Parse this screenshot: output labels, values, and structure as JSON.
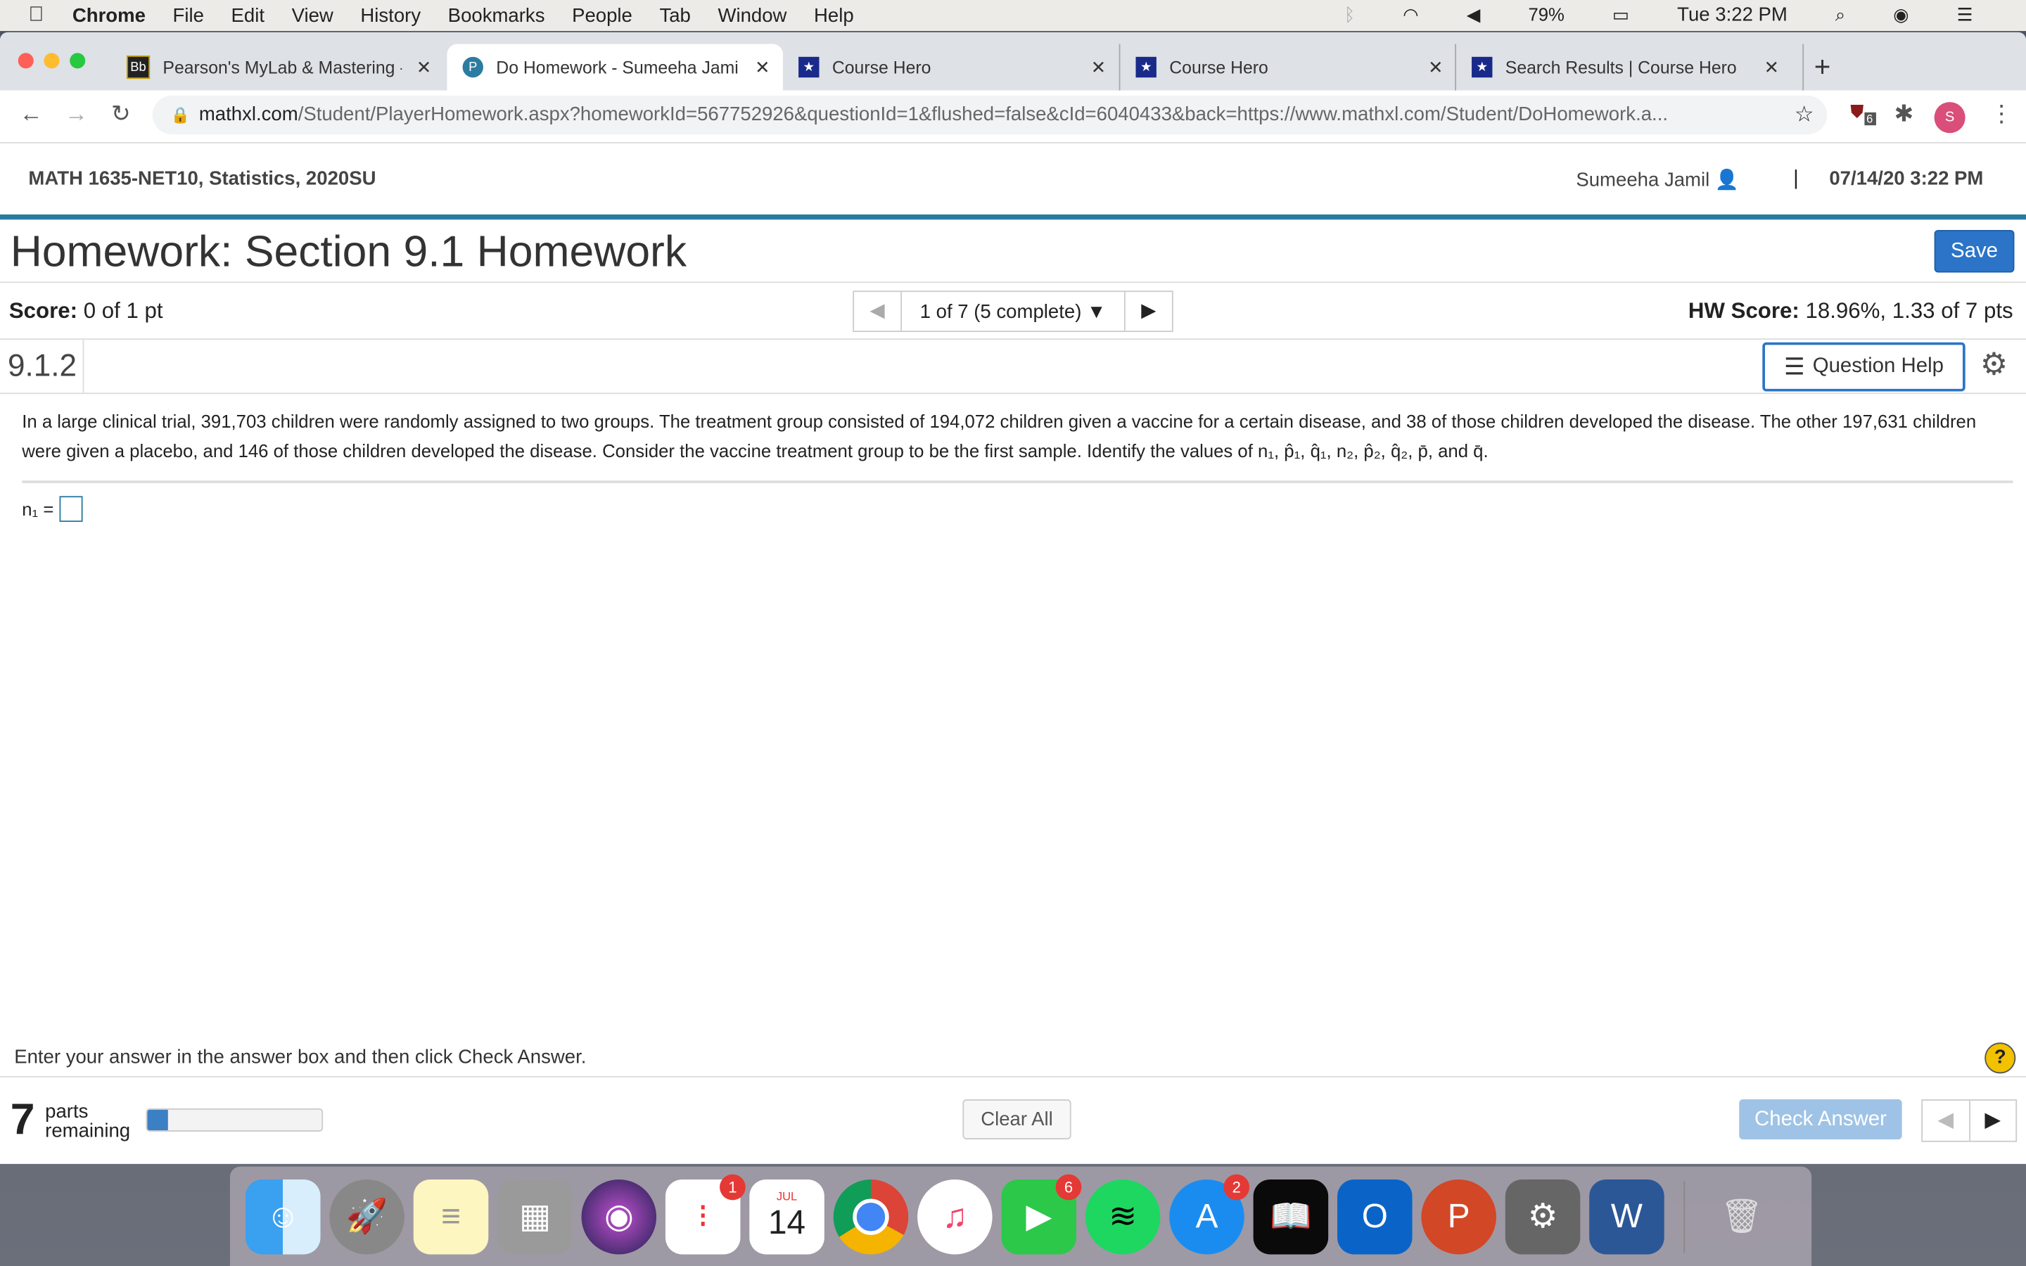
{
  "menubar": {
    "app": "Chrome",
    "items": [
      "File",
      "Edit",
      "View",
      "History",
      "Bookmarks",
      "People",
      "Tab",
      "Window",
      "Help"
    ],
    "battery": "79%",
    "clock": "Tue 3:22 PM"
  },
  "tabs": [
    {
      "title": "Pearson's MyLab & Mastering -",
      "icon": "blackboard-icon",
      "active": false
    },
    {
      "title": "Do Homework - Sumeeha Jamil",
      "icon": "pearson-icon",
      "active": true
    },
    {
      "title": "Course Hero",
      "icon": "course-hero-icon",
      "active": false
    },
    {
      "title": "Course Hero",
      "icon": "course-hero-icon",
      "active": false
    },
    {
      "title": "Search Results | Course Hero",
      "icon": "course-hero-icon",
      "active": false
    }
  ],
  "address": {
    "domain": "mathxl.com",
    "path": "/Student/PlayerHomework.aspx?homeworkId=567752926&questionId=1&flushed=false&cId=6040433&back=https://www.mathxl.com/Student/DoHomework.a...",
    "extension_badge": "6",
    "profile_initial": "S"
  },
  "course": {
    "title": "MATH 1635-NET10, Statistics, 2020SU",
    "user": "Sumeeha Jamil",
    "separator": "|",
    "datetime": "07/14/20 3:22 PM"
  },
  "homework": {
    "title": "Homework: Section 9.1 Homework",
    "save_label": "Save"
  },
  "score": {
    "label": "Score:",
    "value": "0 of 1 pt",
    "pager": "1 of 7 (5 complete)",
    "hw_label": "HW Score:",
    "hw_value": "18.96%, 1.33 of 7 pts"
  },
  "question": {
    "number": "9.1.2",
    "help_label": "Question Help",
    "text1": "In a large clinical trial, 391,703 children were randomly assigned to two groups. The treatment group consisted of 194,072 children given a vaccine for a certain disease, and 38 of those children developed the disease. The other 197,631 children were given a placebo, and 146 of those children developed the disease. Consider the vaccine treatment group to be the first sample. Identify the values of ",
    "vars": "n₁, p̂₁, q̂₁, n₂, p̂₂, q̂₂, p̄, and q̄.",
    "answer_label": "n₁ ="
  },
  "footer": {
    "instruction": "Enter your answer in the answer box and then click Check Answer.",
    "parts_count": "7",
    "parts_text1": "parts",
    "parts_text2": "remaining",
    "progress_percent": 12,
    "clear_label": "Clear All",
    "check_label": "Check Answer",
    "help_glyph": "?"
  },
  "dock": {
    "calendar_month": "JUL",
    "calendar_day": "14",
    "reminders_badge": "1",
    "facetime_badge": "6",
    "appstore_badge": "2"
  },
  "colors": {
    "accent": "#2b74c8",
    "course_bar": "#2a7aa0",
    "check_disabled": "#9ec3e6"
  }
}
